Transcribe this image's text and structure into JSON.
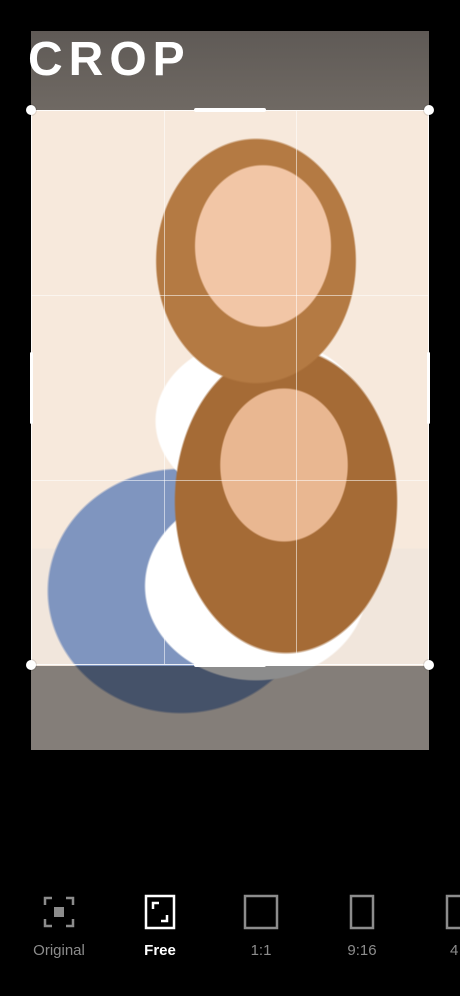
{
  "app": {
    "screen_title": "CROP"
  },
  "editor": {
    "photo": "two young women making kissy faces, one piggybacking on the other"
  },
  "aspect_toolbar": {
    "items": [
      {
        "label": "Original",
        "icon": "original-ratio-icon",
        "active": false
      },
      {
        "label": "Free",
        "icon": "free-crop-icon",
        "active": true
      },
      {
        "label": "1:1",
        "icon": "square-ratio-icon",
        "active": false
      },
      {
        "label": "9:16",
        "icon": "portrait-ratio-icon",
        "active": false
      },
      {
        "label": "4",
        "icon": "partial-ratio-icon",
        "active": false
      }
    ]
  },
  "colors": {
    "background": "#000000",
    "active": "#ffffff",
    "inactive": "#8c8c8c",
    "frame": "#ffffff"
  }
}
